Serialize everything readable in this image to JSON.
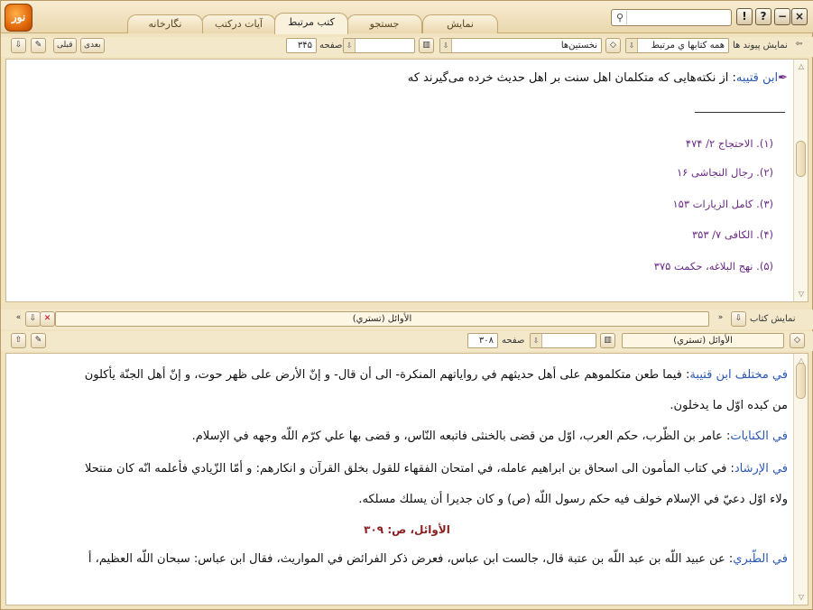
{
  "app": {
    "logo_text": "نور"
  },
  "tabs": [
    {
      "label": "نمایش"
    },
    {
      "label": "جستجو"
    },
    {
      "label": "کتب مرتبط"
    },
    {
      "label": "آیات درکتب"
    },
    {
      "label": "نگارخانه"
    }
  ],
  "window_buttons": [
    "×",
    "−",
    "?",
    "!"
  ],
  "top_toolbar": {
    "back": "⇦",
    "show_links_label": "نمايش پيوند ها",
    "books_select": "همه كتابها ي مرتبط",
    "first_select": "نخستين‌ها",
    "page_label": "صفحه",
    "page_value": "۳۴۵",
    "next_label": "بعدی",
    "prev_label": "قبلی"
  },
  "upper_content": {
    "source": "ابن قتيبه",
    "text": ": از نکته‌هایی که متکلمان اهل سنت بر اهل حدیث خرده می‌گیرند که",
    "footnotes": [
      "(۱). الاحتجاج ۲/ ۴۷۴",
      "(۲). رجال النجاشی ۱۶",
      "(۳). کامل الزیارات ۱۵۳",
      "(۴). الكافى ۷/ ۳۵۳",
      "(۵). نهج البلاغه، حکمت ۳۷۵"
    ]
  },
  "lower_toolbar": {
    "show_book_label": "نمايش كتاب",
    "book_title": "الأوائل (تستري)",
    "book_select": "الأوائل (تستري)",
    "page_label": "صفحه",
    "page_value": "۳۰۸"
  },
  "lower_content": {
    "p1_source": "في مختلف ابن قتيبة",
    "p1_text": ": فيما طعن متكلموهم على أهل حديثهم في رواياتهم المنكرة- الى أن قال- و إنّ الأرض على ظهر حوت، و إنّ أهل الجنّة يأكلون",
    "p1_cont": "من كبده اوّل ما يدخلون.",
    "p2_source": "في الكنايات",
    "p2_text": ": عامر بن الظّرب، حكم العرب، اوّل من قضى بالخنثى فاتبعه النّاس، و قضى بها علي كرّم اللّه وجهه في الإسلام.",
    "p3_source": "في الإرشاد",
    "p3_text": ": في كتاب المأمون الى اسحاق بن ابراهيم عامله، في امتحان الفقهاء للقول بخلق القرآن و انكارهم: و أمّا الزّيادي فأعلمه انّه كان منتحلا",
    "p3_cont": "ولاء اوّل دعيّ في الإسلام خولف فيه حكم رسول اللّه (ص) و كان جديرا أن يسلك مسلكه.",
    "page_marker": "الأوائل، ص: ۳۰۹",
    "p4_source": "في الطّبري",
    "p4_text": ": عن عبيد اللّه بن عبد اللّه بن عتبة قال، جالست ابن عباس، فعرض ذكر الفرائض في المواريث، فقال ابن عباس: سبحان اللّه العظيم، أ"
  }
}
